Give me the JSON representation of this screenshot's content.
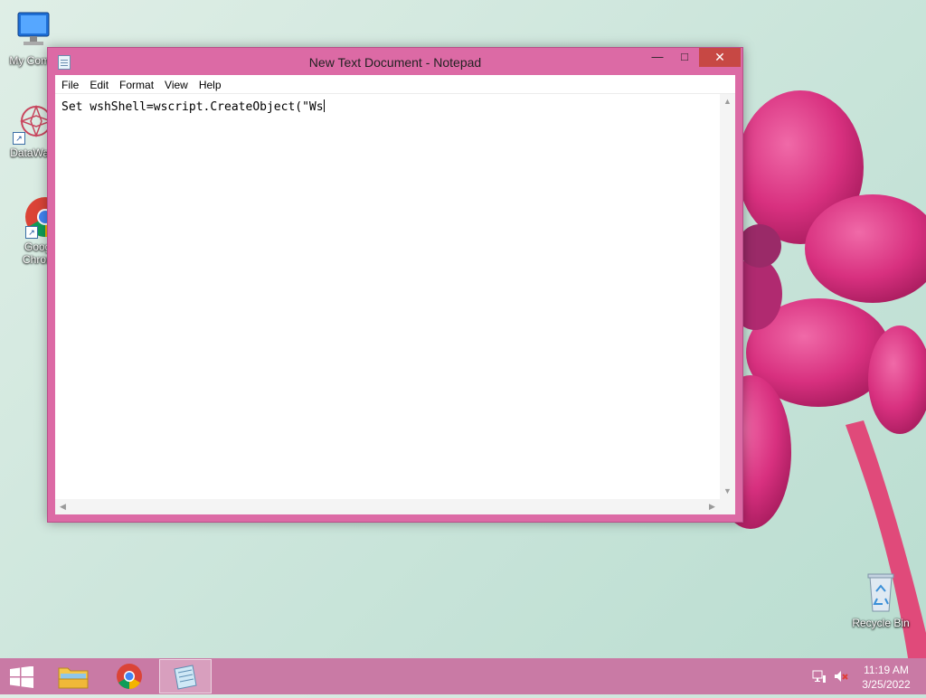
{
  "desktop": {
    "icons": [
      {
        "label": "My Comp",
        "icon": "computer-icon"
      },
      {
        "label": "DataWag",
        "icon": "datawag-icon"
      },
      {
        "label": "Googl\nChrom",
        "icon": "chrome-icon"
      },
      {
        "label": "Recycle Bin",
        "icon": "recycle-bin-icon"
      }
    ]
  },
  "window": {
    "title": "New Text Document - Notepad",
    "minimize_glyph": "—",
    "maximize_glyph": "□",
    "close_glyph": "✕",
    "menu": [
      "File",
      "Edit",
      "Format",
      "View",
      "Help"
    ],
    "content": "Set wshShell=wscript.CreateObject(\"Ws",
    "scroll_up": "▲",
    "scroll_down": "▼",
    "scroll_left": "◀",
    "scroll_right": "▶"
  },
  "taskbar": {
    "apps": [
      {
        "name": "file-explorer",
        "icon": "folder-icon"
      },
      {
        "name": "chrome",
        "icon": "chrome-icon"
      },
      {
        "name": "notepad",
        "icon": "notepad-icon",
        "active": true
      }
    ],
    "time": "11:19 AM",
    "date": "3/25/2022"
  },
  "colors": {
    "window_frame": "#dc6aa5",
    "taskbar": "#c97aa5",
    "close_button": "#c74844"
  }
}
